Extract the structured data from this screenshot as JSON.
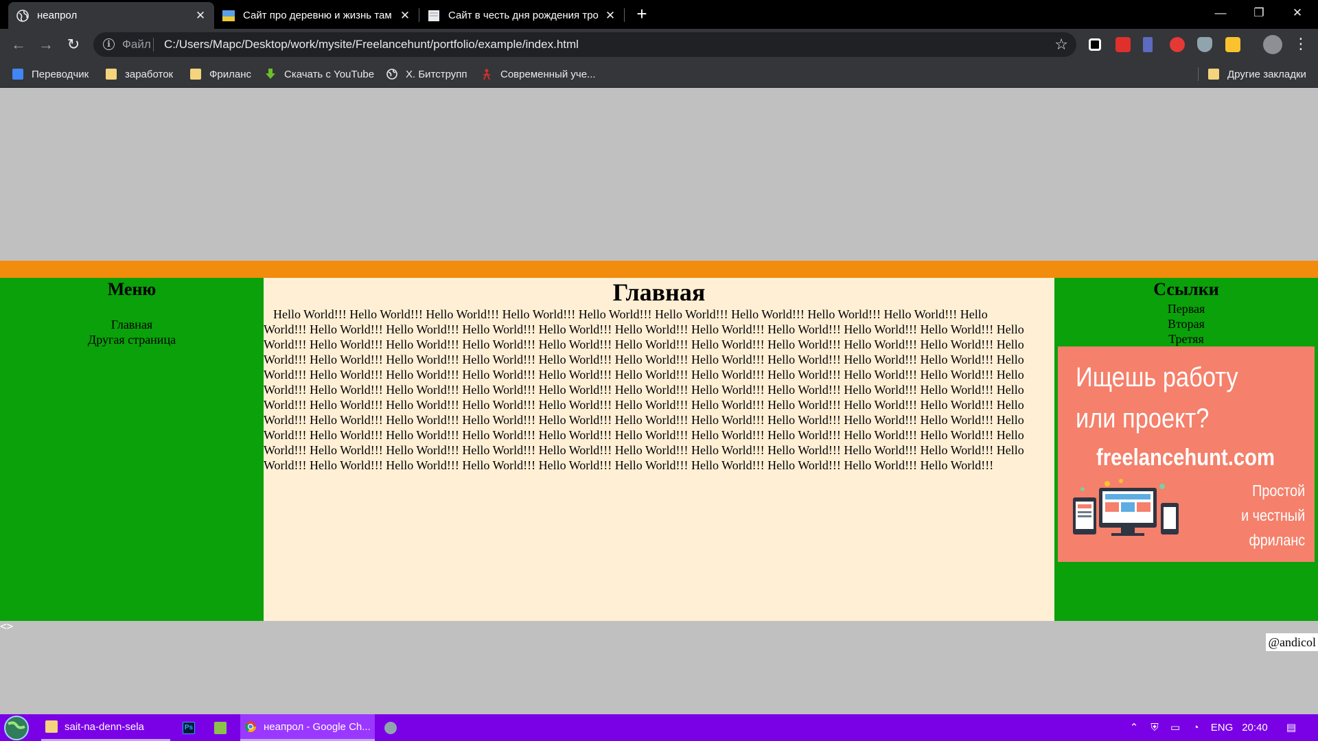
{
  "browser": {
    "tabs": [
      {
        "title": "неапрол",
        "active": true
      },
      {
        "title": "Сайт про деревню и жизнь там",
        "active": false
      },
      {
        "title": "Сайт в честь дня рождения тро",
        "active": false
      }
    ],
    "new_tab_label": "+",
    "window_controls": {
      "minimize": "—",
      "maximize": "❐",
      "close": "✕"
    },
    "address": {
      "scheme": "Файл",
      "url": "C:/Users/Марс/Desktop/work/mysite/Freelancehunt/portfolio/example/index.html"
    },
    "bookmarks": [
      {
        "label": "Переводчик",
        "icon": "google-translate-icon"
      },
      {
        "label": "заработок",
        "icon": "folder-icon"
      },
      {
        "label": "Фриланс",
        "icon": "folder-icon"
      },
      {
        "label": "Скачать с YouTube",
        "icon": "download-arrow-icon"
      },
      {
        "label": "X. Битструпп",
        "icon": "globe-icon"
      },
      {
        "label": "Современный уче...",
        "icon": "person-icon"
      }
    ],
    "other_bookmarks": "Другие закладки"
  },
  "page": {
    "colors": {
      "background": "#c0c0c0",
      "orange_bar": "#f28c0c",
      "side": "#0aa10a",
      "center": "#ffefd5"
    },
    "menu": {
      "heading": "Меню",
      "items": [
        "Главная",
        "Другая страница"
      ]
    },
    "main": {
      "heading": "Главная",
      "body_text": "Hello World!!! Hello World!!! Hello World!!! Hello World!!! Hello World!!! Hello World!!! Hello World!!! Hello World!!! Hello World!!! Hello World!!! Hello World!!! Hello World!!! Hello World!!! Hello World!!! Hello World!!! Hello World!!! Hello World!!! Hello World!!! Hello World!!! Hello World!!! Hello World!!! Hello World!!! Hello World!!! Hello World!!! Hello World!!! Hello World!!! Hello World!!! Hello World!!! Hello World!!! Hello World!!! Hello World!!! Hello World!!! Hello World!!! Hello World!!! Hello World!!! Hello World!!! Hello World!!! Hello World!!! Hello World!!! Hello World!!! Hello World!!! Hello World!!! Hello World!!! Hello World!!! Hello World!!! Hello World!!! Hello World!!! Hello World!!! Hello World!!! Hello World!!! Hello World!!! Hello World!!! Hello World!!! Hello World!!! Hello World!!! Hello World!!! Hello World!!! Hello World!!! Hello World!!! Hello World!!! Hello World!!! Hello World!!! Hello World!!! Hello World!!! Hello World!!! Hello World!!! Hello World!!! Hello World!!! Hello World!!! Hello World!!! Hello World!!! Hello World!!! Hello World!!! Hello World!!! Hello World!!! Hello World!!! Hello World!!! Hello World!!! Hello World!!! Hello World!!! Hello World!!! Hello World!!! Hello World!!! Hello World!!! Hello World!!! Hello World!!! Hello World!!! Hello World!!! Hello World!!! Hello World!!! Hello World!!! Hello World!!! Hello World!!! Hello World!!! Hello World!!! Hello World!!! Hello World!!! Hello World!!! Hello World!!! Hello World!!! Hello World!!! Hello World!!! Hello World!!! Hello World!!! Hello World!!! Hello World!!! Hello World!!! Hello World!!! Hello World!!!"
    },
    "links": {
      "heading": "Ссылки",
      "items": [
        "Первая",
        "Вторая",
        "Третяя"
      ]
    },
    "ad": {
      "line1": "Ищешь работу",
      "line2": "или проект?",
      "domain": "freelancehunt.com",
      "tagline": [
        "Простой",
        "и честный",
        "фриланс"
      ],
      "background": "#f5806b"
    },
    "footer_mark": "<>",
    "copyright": "@andicol"
  },
  "taskbar": {
    "items": [
      {
        "label": "sait-na-denn-sela",
        "icon": "folder-icon"
      },
      {
        "label": "",
        "icon": "photoshop-icon"
      },
      {
        "label": "",
        "icon": "notepad-icon"
      },
      {
        "label": "неапрол - Google Ch...",
        "icon": "chrome-icon"
      },
      {
        "label": "",
        "icon": "app-icon"
      }
    ],
    "tray": {
      "language": "ENG",
      "time": "20:40"
    }
  }
}
